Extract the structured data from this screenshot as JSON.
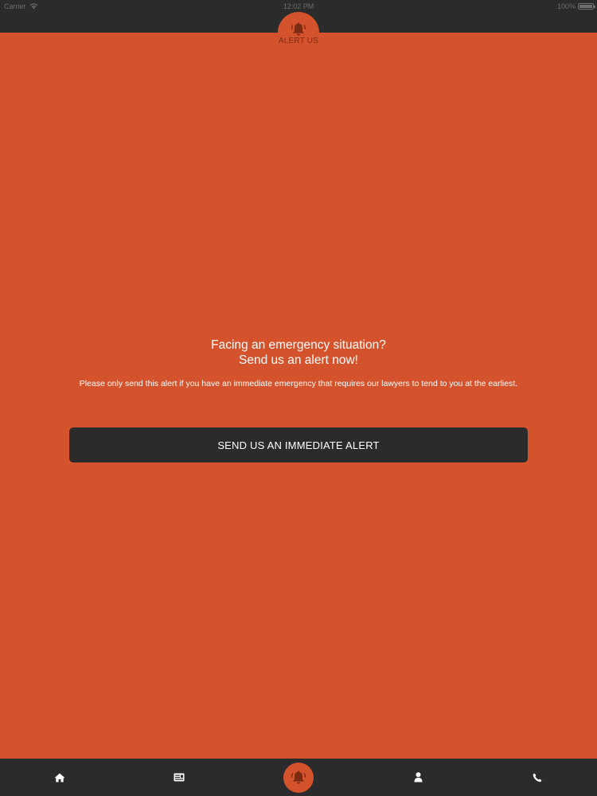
{
  "status_bar": {
    "carrier": "Carrier",
    "time": "12:02 PM",
    "battery": "100%"
  },
  "nav": {
    "title": "ALERT US",
    "icon": "bell-icon"
  },
  "main": {
    "headline_line1": "Facing an emergency situation?",
    "headline_line2": "Send us an alert now!",
    "subtext": "Please only send this alert if you have an immediate emergency that requires our lawyers to tend to you at the earliest.",
    "button_label": "SEND US AN IMMEDIATE ALERT"
  },
  "tab_bar": {
    "items": [
      {
        "icon": "home-icon"
      },
      {
        "icon": "news-icon"
      },
      {
        "icon": "bell-icon",
        "active": true
      },
      {
        "icon": "user-icon"
      },
      {
        "icon": "phone-icon"
      }
    ]
  },
  "colors": {
    "background": "#d5532c",
    "bar": "#2b2b2b",
    "nav_title": "#7c2a12",
    "text": "#ffffff"
  }
}
